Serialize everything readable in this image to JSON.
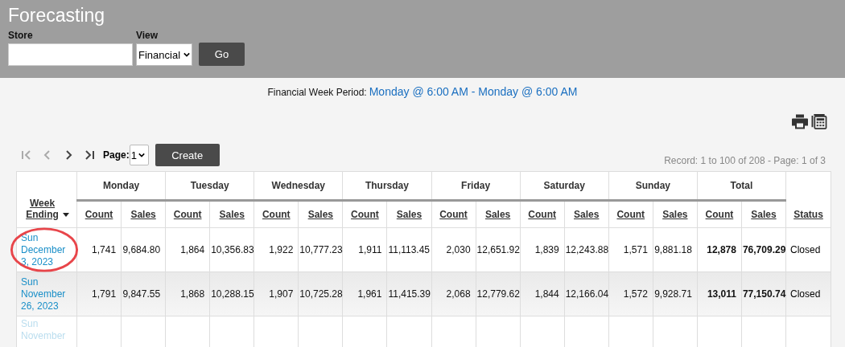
{
  "header": {
    "title": "Forecasting",
    "store": {
      "label": "Store"
    },
    "view": {
      "label": "View",
      "value": "Financial"
    },
    "go_button": "Go"
  },
  "period": {
    "label": "Financial Week Period:",
    "value": "Monday @ 6:00 AM - Monday @ 6:00 AM"
  },
  "pager": {
    "buttons": [
      {
        "kind": "first",
        "disabled": true
      },
      {
        "kind": "prev",
        "disabled": true
      },
      {
        "kind": "next",
        "disabled": false
      },
      {
        "kind": "last",
        "disabled": false
      }
    ],
    "page_label": "Page:",
    "page_value": "1",
    "create_button": "Create",
    "record": "Record: 1 to 100 of 208 - Page: 1 of 3"
  },
  "table": {
    "week_column": "Week Ending",
    "status_column": "Status",
    "groups": [
      {
        "name": "Monday",
        "kind": "day",
        "subcolumns": [
          "Count",
          "Sales"
        ]
      },
      {
        "name": "Tuesday",
        "kind": "day",
        "subcolumns": [
          "Count",
          "Sales"
        ]
      },
      {
        "name": "Wednesday",
        "kind": "day",
        "subcolumns": [
          "Count",
          "Sales"
        ]
      },
      {
        "name": "Thursday",
        "kind": "day",
        "subcolumns": [
          "Count",
          "Sales"
        ]
      },
      {
        "name": "Friday",
        "kind": "day",
        "subcolumns": [
          "Count",
          "Sales"
        ]
      },
      {
        "name": "Saturday",
        "kind": "day",
        "subcolumns": [
          "Count",
          "Sales"
        ]
      },
      {
        "name": "Sunday",
        "kind": "day",
        "subcolumns": [
          "Count",
          "Sales"
        ]
      },
      {
        "name": "Total",
        "kind": "total",
        "subcolumns": [
          "Count",
          "Sales"
        ]
      }
    ],
    "rows": [
      {
        "date": "Sun December 3, 2023",
        "circled": true,
        "faded": false,
        "cells": [
          "1,741",
          "9,684.80",
          "1,864",
          "10,356.83",
          "1,922",
          "10,777.23",
          "1,911",
          "11,113.45",
          "2,030",
          "12,651.92",
          "1,839",
          "12,243.88",
          "1,571",
          "9,881.18",
          "12,878",
          "76,709.29"
        ],
        "status": "Closed"
      },
      {
        "date": "Sun November 26, 2023",
        "circled": false,
        "faded": false,
        "cells": [
          "1,791",
          "9,847.55",
          "1,868",
          "10,288.15",
          "1,907",
          "10,725.28",
          "1,961",
          "11,415.39",
          "2,068",
          "12,779.62",
          "1,844",
          "12,166.04",
          "1,572",
          "9,928.71",
          "13,011",
          "77,150.74"
        ],
        "status": "Closed"
      },
      {
        "date": "Sun November",
        "circled": false,
        "faded": true
      }
    ]
  }
}
